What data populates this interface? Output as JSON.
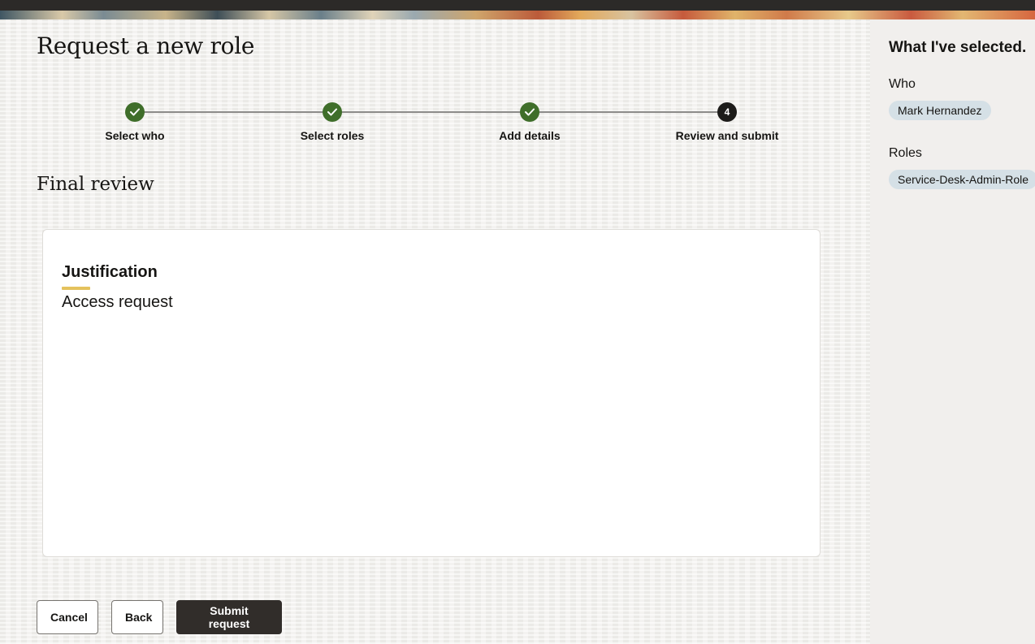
{
  "page": {
    "title": "Request a new role",
    "section_title": "Final review"
  },
  "stepper": {
    "steps": [
      {
        "label": "Select who",
        "state": "complete",
        "icon": "check-icon"
      },
      {
        "label": "Select roles",
        "state": "complete",
        "icon": "check-icon"
      },
      {
        "label": "Add details",
        "state": "complete",
        "icon": "check-icon"
      },
      {
        "label": "Review and submit",
        "state": "current",
        "number": "4"
      }
    ],
    "colors": {
      "complete": "#3f6e2a",
      "current": "#1d1c1a"
    }
  },
  "review": {
    "justification_label": "Justification",
    "justification_value": "Access request",
    "accent_color": "#e4c25d"
  },
  "actions": {
    "cancel": "Cancel",
    "back": "Back",
    "submit": "Submit request"
  },
  "sidebar": {
    "title": "What I've selected.",
    "who_label": "Who",
    "who_value": "Mark Hernandez",
    "roles_label": "Roles",
    "roles_value": "Service-Desk-Admin-Role",
    "chip_color": "#d5e0e6"
  }
}
